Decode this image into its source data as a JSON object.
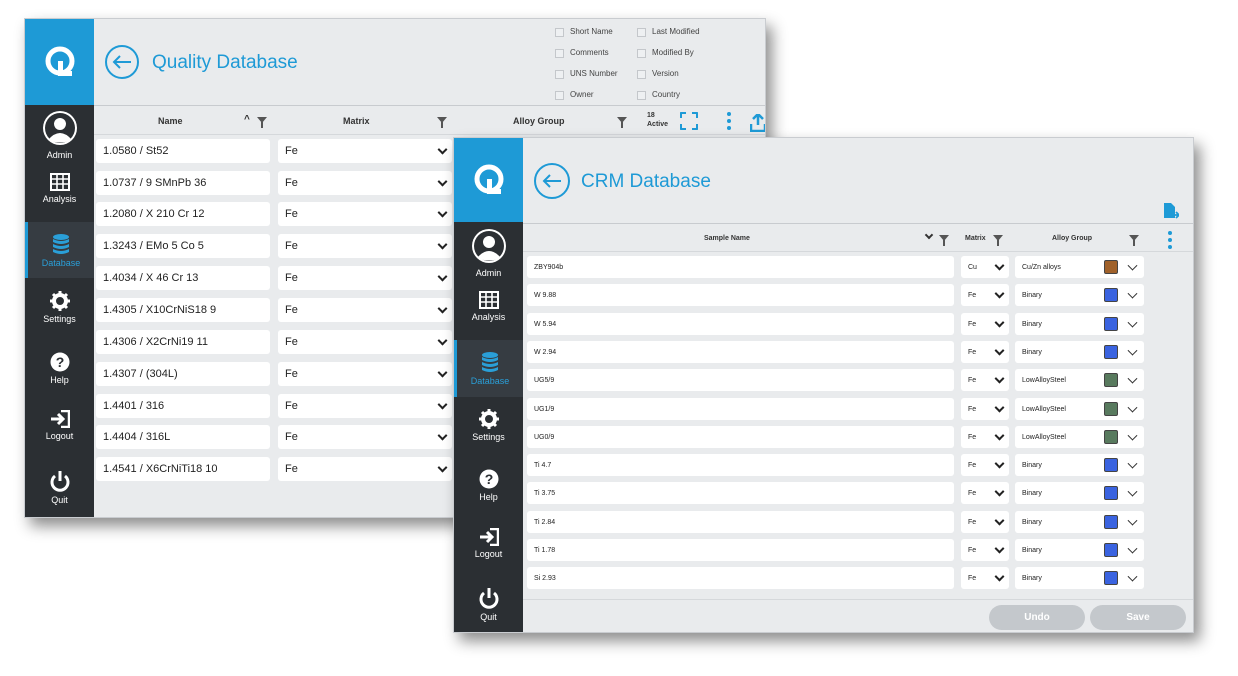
{
  "quality": {
    "title": "Quality Database",
    "sidebar": [
      {
        "label": "Admin",
        "icon": "user-icon"
      },
      {
        "label": "Analysis",
        "icon": "grid-icon"
      },
      {
        "label": "Database",
        "icon": "database-icon"
      },
      {
        "label": "Settings",
        "icon": "gear-icon"
      },
      {
        "label": "Help",
        "icon": "help-icon"
      },
      {
        "label": "Logout",
        "icon": "logout-icon"
      },
      {
        "label": "Quit",
        "icon": "power-icon"
      }
    ],
    "column_options": [
      {
        "label": "Short Name"
      },
      {
        "label": "Last Modified"
      },
      {
        "label": "Comments"
      },
      {
        "label": "Modified By"
      },
      {
        "label": "UNS Number"
      },
      {
        "label": "Version"
      },
      {
        "label": "Owner"
      },
      {
        "label": "Country"
      }
    ],
    "headers": {
      "name": "Name",
      "matrix": "Matrix",
      "alloy_group": "Alloy Group",
      "active_count": "18",
      "active_label": "Active"
    },
    "rows": [
      {
        "name": "1.0580 / St52",
        "matrix": "Fe"
      },
      {
        "name": "1.0737 / 9 SMnPb 36",
        "matrix": "Fe"
      },
      {
        "name": "1.2080 / X 210 Cr 12",
        "matrix": "Fe"
      },
      {
        "name": "1.3243 / EMo 5 Co 5",
        "matrix": "Fe"
      },
      {
        "name": "1.4034 / X 46 Cr 13",
        "matrix": "Fe"
      },
      {
        "name": "1.4305 / X10CrNiS18 9",
        "matrix": "Fe"
      },
      {
        "name": "1.4306 / X2CrNi19 11",
        "matrix": "Fe"
      },
      {
        "name": "1.4307 / (304L)",
        "matrix": "Fe"
      },
      {
        "name": "1.4401 / 316",
        "matrix": "Fe"
      },
      {
        "name": "1.4404 / 316L",
        "matrix": "Fe"
      },
      {
        "name": "1.4541 / X6CrNiTi18 10",
        "matrix": "Fe"
      }
    ]
  },
  "crm": {
    "title": "CRM Database",
    "sidebar": [
      {
        "label": "Admin",
        "icon": "user-icon"
      },
      {
        "label": "Analysis",
        "icon": "grid-icon"
      },
      {
        "label": "Database",
        "icon": "database-icon"
      },
      {
        "label": "Settings",
        "icon": "gear-icon"
      },
      {
        "label": "Help",
        "icon": "help-icon"
      },
      {
        "label": "Logout",
        "icon": "logout-icon"
      },
      {
        "label": "Quit",
        "icon": "power-icon"
      }
    ],
    "headers": {
      "sample_name": "Sample Name",
      "matrix": "Matrix",
      "alloy_group": "Alloy Group"
    },
    "rows": [
      {
        "name": "ZBY904b",
        "matrix": "Cu",
        "group": "Cu/Zn alloys",
        "color": "#a0612a"
      },
      {
        "name": "W 9.88",
        "matrix": "Fe",
        "group": "Binary",
        "color": "#3a63e0"
      },
      {
        "name": "W 5.94",
        "matrix": "Fe",
        "group": "Binary",
        "color": "#3a63e0"
      },
      {
        "name": "W 2.94",
        "matrix": "Fe",
        "group": "Binary",
        "color": "#3a63e0"
      },
      {
        "name": "UG5/9",
        "matrix": "Fe",
        "group": "LowAlloySteel",
        "color": "#587a5e"
      },
      {
        "name": "UG1/9",
        "matrix": "Fe",
        "group": "LowAlloySteel",
        "color": "#587a5e"
      },
      {
        "name": "UG0/9",
        "matrix": "Fe",
        "group": "LowAlloySteel",
        "color": "#587a5e"
      },
      {
        "name": "Ti 4.7",
        "matrix": "Fe",
        "group": "Binary",
        "color": "#3a63e0"
      },
      {
        "name": "Ti 3.75",
        "matrix": "Fe",
        "group": "Binary",
        "color": "#3a63e0"
      },
      {
        "name": "Ti 2.84",
        "matrix": "Fe",
        "group": "Binary",
        "color": "#3a63e0"
      },
      {
        "name": "Ti 1.78",
        "matrix": "Fe",
        "group": "Binary",
        "color": "#3a63e0"
      },
      {
        "name": "Si 2.93",
        "matrix": "Fe",
        "group": "Binary",
        "color": "#3a63e0"
      }
    ],
    "buttons": {
      "undo": "Undo",
      "save": "Save"
    }
  }
}
